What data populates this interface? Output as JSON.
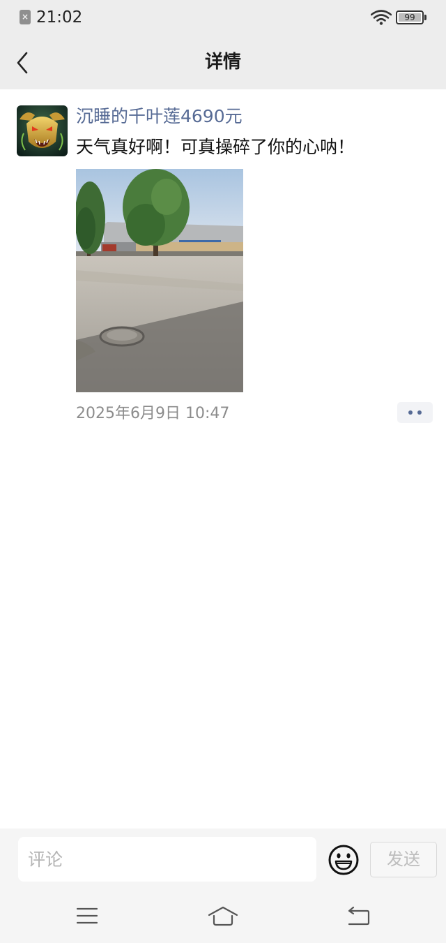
{
  "status_bar": {
    "time": "21:02",
    "sim_icon": "sim-missing-icon",
    "wifi_icon": "wifi-icon",
    "battery_level": "99"
  },
  "nav": {
    "title": "详情",
    "back_icon": "chevron-left-icon"
  },
  "post": {
    "avatar_icon": "dragon-avatar",
    "username": "沉睡的千叶莲4690元",
    "text": "天气真好啊！可真操碎了你的心呐！",
    "photo": "courtyard-photo",
    "timestamp": "2025年6月9日 10:47",
    "more_icon": "more-dots-icon"
  },
  "comment_bar": {
    "placeholder": "评论",
    "emoji_icon": "smiley-icon",
    "send_label": "发送"
  },
  "system_nav": {
    "menu_icon": "menu-icon",
    "home_icon": "home-icon",
    "back_icon": "back-icon"
  },
  "colors": {
    "link": "#576b95",
    "bar_bg": "#ededed",
    "bottom_bg": "#f5f5f5"
  }
}
